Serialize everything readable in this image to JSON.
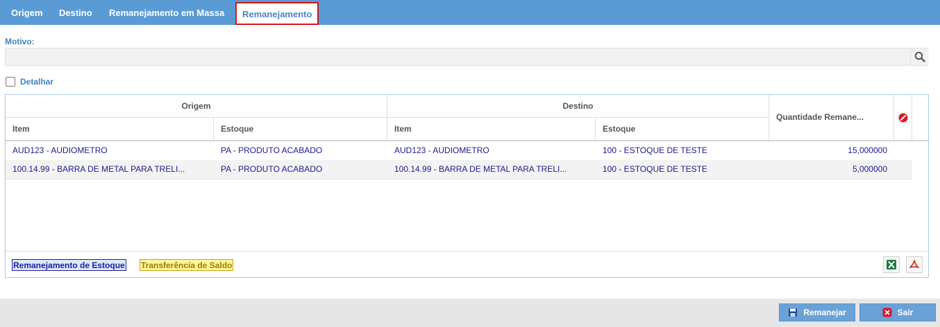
{
  "tabs": [
    {
      "label": "Origem",
      "active": false
    },
    {
      "label": "Destino",
      "active": false
    },
    {
      "label": "Remanejamento em Massa",
      "active": false
    },
    {
      "label": "Remanejamento",
      "active": true
    }
  ],
  "motivo": {
    "label": "Motivo:",
    "value": ""
  },
  "detalhar": {
    "label": "Detalhar",
    "checked": false
  },
  "grid": {
    "group_headers": {
      "origem": "Origem",
      "destino": "Destino"
    },
    "columns": {
      "origem_item": "Item",
      "origem_estoque": "Estoque",
      "destino_item": "Item",
      "destino_estoque": "Estoque",
      "quantidade": "Quantidade Remane..."
    },
    "rows": [
      {
        "origem_item": "AUD123 - AUDIOMETRO",
        "origem_estoque": "PA - PRODUTO ACABADO",
        "destino_item": "AUD123 - AUDIOMETRO",
        "destino_estoque": "100 - ESTOQUE DE TESTE",
        "quantidade": "15,000000"
      },
      {
        "origem_item": "100.14.99 - BARRA DE METAL PARA TRELI...",
        "origem_estoque": "PA - PRODUTO ACABADO",
        "destino_item": "100.14.99 - BARRA DE METAL PARA TRELI...",
        "destino_estoque": "100 - ESTOQUE DE TESTE",
        "quantidade": "5,000000"
      }
    ],
    "legend": {
      "remanejamento": "Remanejamento de Estoque",
      "transferencia": "Transferência de Saldo"
    }
  },
  "buttons": {
    "remanejar": "Remanejar",
    "sair": "Sair"
  },
  "colors": {
    "accent": "#5b9bd5",
    "active_tab_border": "#d8151b",
    "row_text": "#1a1a8c",
    "legend_blue": "#1c1ca0",
    "legend_yellow": "#fff699"
  },
  "icons": {
    "motivo_search": "search-icon",
    "header_action": "edit-icon",
    "export_excel": "excel-icon",
    "export_pdf": "pdf-icon",
    "remanejar": "save-icon",
    "sair": "close-icon"
  }
}
